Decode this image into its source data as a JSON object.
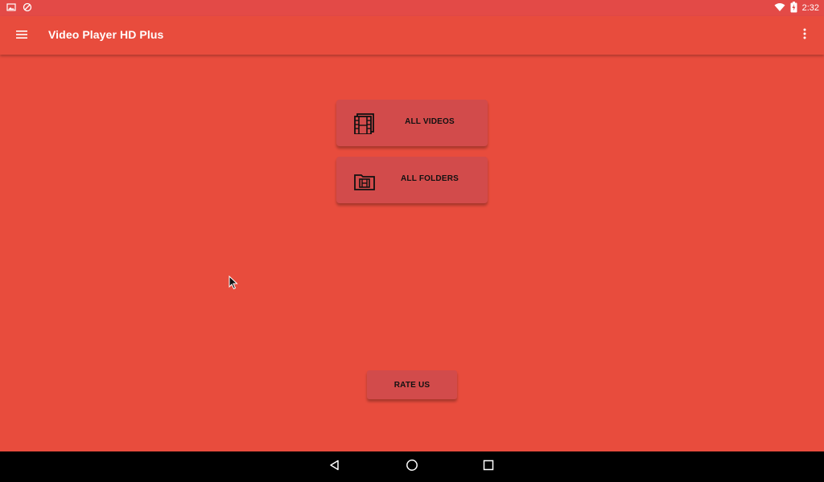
{
  "status_bar": {
    "time": "2:32",
    "left_icons": [
      "image-icon",
      "sync-disabled-icon"
    ],
    "right_icons": [
      "wifi-icon",
      "battery-charging-icon"
    ]
  },
  "app_bar": {
    "title": "Video Player HD Plus",
    "menu_icon": "hamburger-menu-icon",
    "overflow_icon": "more-vertical-icon"
  },
  "main": {
    "all_videos_label": "ALL VIDEOS",
    "all_videos_icon": "film-strip-icon",
    "all_folders_label": "ALL FOLDERS",
    "all_folders_icon": "video-folder-icon",
    "rate_us_label": "RATE US"
  },
  "nav_bar": {
    "back_icon": "back-triangle-icon",
    "home_icon": "home-circle-icon",
    "recents_icon": "recents-square-icon"
  },
  "colors": {
    "background": "#e84c3d",
    "button": "#d24b4b",
    "status_bar": "#e34a47",
    "nav_bar": "#000000"
  }
}
